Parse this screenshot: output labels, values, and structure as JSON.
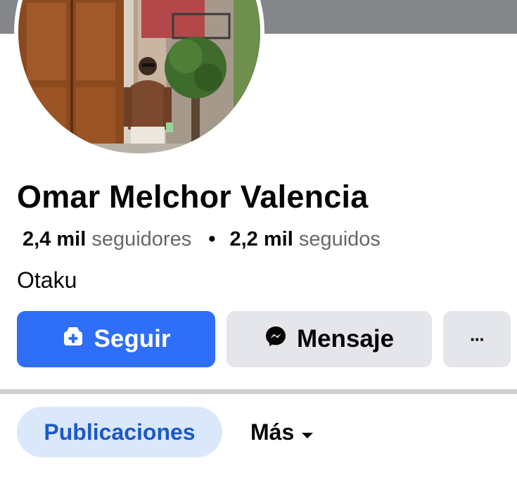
{
  "profile": {
    "name": "Omar Melchor Valencia",
    "followers_count": "2,4 mil",
    "followers_label": "seguidores",
    "following_count": "2,2 mil",
    "following_label": "seguidos",
    "bio": "Otaku"
  },
  "actions": {
    "follow_label": "Seguir",
    "message_label": "Mensaje",
    "more_label": "···"
  },
  "tabs": {
    "posts_label": "Publicaciones",
    "more_label": "Más"
  },
  "icons": {
    "follow": "add-friend-icon",
    "message": "messenger-icon",
    "more_tab": "caret-down-icon"
  },
  "colors": {
    "primary": "#2f6ef6",
    "secondary_button": "#e4e6eb",
    "active_tab_bg": "#dbe7fb",
    "active_tab_text": "#1b59c9",
    "cover": "#85868a"
  }
}
